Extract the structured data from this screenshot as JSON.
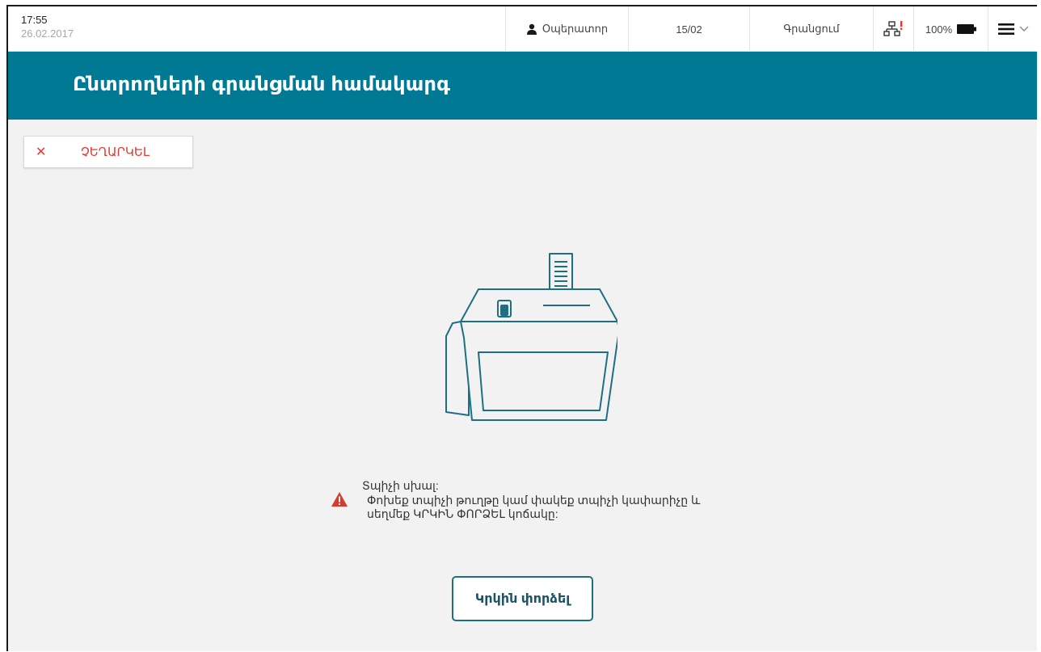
{
  "statusbar": {
    "time": "17:55",
    "date": "26.02.2017",
    "operator_icon": "user-icon",
    "operator": "Օպերատոր",
    "count": "15/02",
    "mode": "Գրանցում",
    "network_icon": "network-error-icon",
    "battery_percent": "100%",
    "battery_icon": "battery-full-icon",
    "menu_icon": "hamburger-menu-icon"
  },
  "header": {
    "title": "Ընտրողների գրանցման համակարգ"
  },
  "cancel": {
    "icon": "close-icon",
    "label": "ՉԵՂԱՐԿԵԼ"
  },
  "device_illustration": "scanner-device-icon",
  "error": {
    "icon": "warning-icon",
    "title": "Տպիչի սխալ:",
    "message": "Փոխեք տպիչի թուղթը կամ փակեք տպիչի կափարիչը և սեղմեք ԿՐԿԻՆ ՓՈՐՁԵԼ կոճակը:"
  },
  "retry": {
    "label": "Կրկին փորձել"
  },
  "colors": {
    "header": "#007a94",
    "cancel": "#e03a2f",
    "warning": "#d93a2e",
    "retry_border": "#1e6e84",
    "background": "#f2f2f2"
  }
}
